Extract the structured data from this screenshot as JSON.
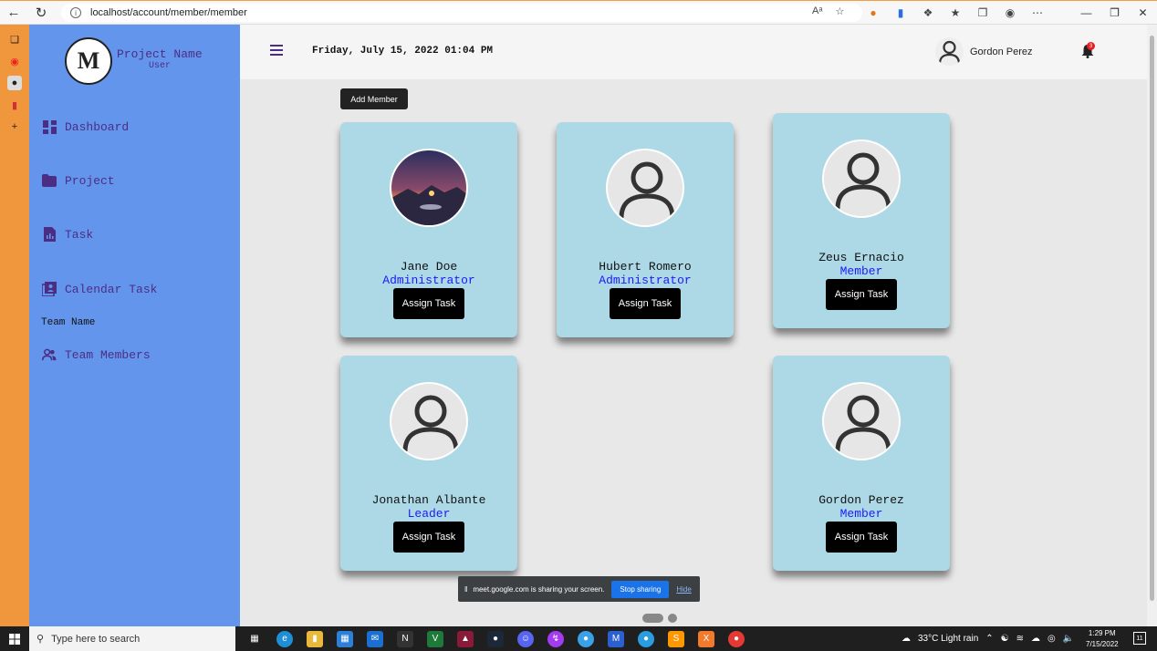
{
  "browser": {
    "url": "localhost/account/member/member"
  },
  "app": {
    "project_name": "Project Name",
    "role": "User",
    "logo_text": "M"
  },
  "sidebar": {
    "items": [
      {
        "label": "Dashboard",
        "icon": "dashboard-icon"
      },
      {
        "label": "Project",
        "icon": "folder-icon"
      },
      {
        "label": "Task",
        "icon": "task-report-icon"
      },
      {
        "label": "Calendar Task",
        "icon": "calendar-task-icon"
      },
      {
        "label": "Team Members",
        "icon": "team-members-icon"
      }
    ],
    "team_name_label": "Team Name"
  },
  "header": {
    "datetime": "Friday, July 15, 2022 01:04 PM",
    "user_name": "Gordon Perez",
    "notification_count": "3"
  },
  "main": {
    "add_member_label": "Add Member",
    "assign_label": "Assign Task",
    "members": [
      {
        "name": "Jane Doe",
        "role": "Administrator",
        "avatar": "landscape-photo"
      },
      {
        "name": "Hubert Romero",
        "role": "Administrator",
        "avatar": "default-user-icon"
      },
      {
        "name": "Zeus Ernacio",
        "role": "Member",
        "avatar": "default-user-icon"
      },
      {
        "name": "Jonathan Albante",
        "role": "Leader",
        "avatar": "default-user-icon"
      },
      {
        "name": "Gordon Perez",
        "role": "Member",
        "avatar": "default-user-icon"
      }
    ]
  },
  "share_banner": {
    "text": "meet.google.com is sharing your screen.",
    "stop_label": "Stop sharing",
    "hide_label": "Hide"
  },
  "taskbar": {
    "search_placeholder": "Type here to search",
    "weather": "33°C  Light rain",
    "time": "1:29 PM",
    "date": "7/15/2022"
  }
}
